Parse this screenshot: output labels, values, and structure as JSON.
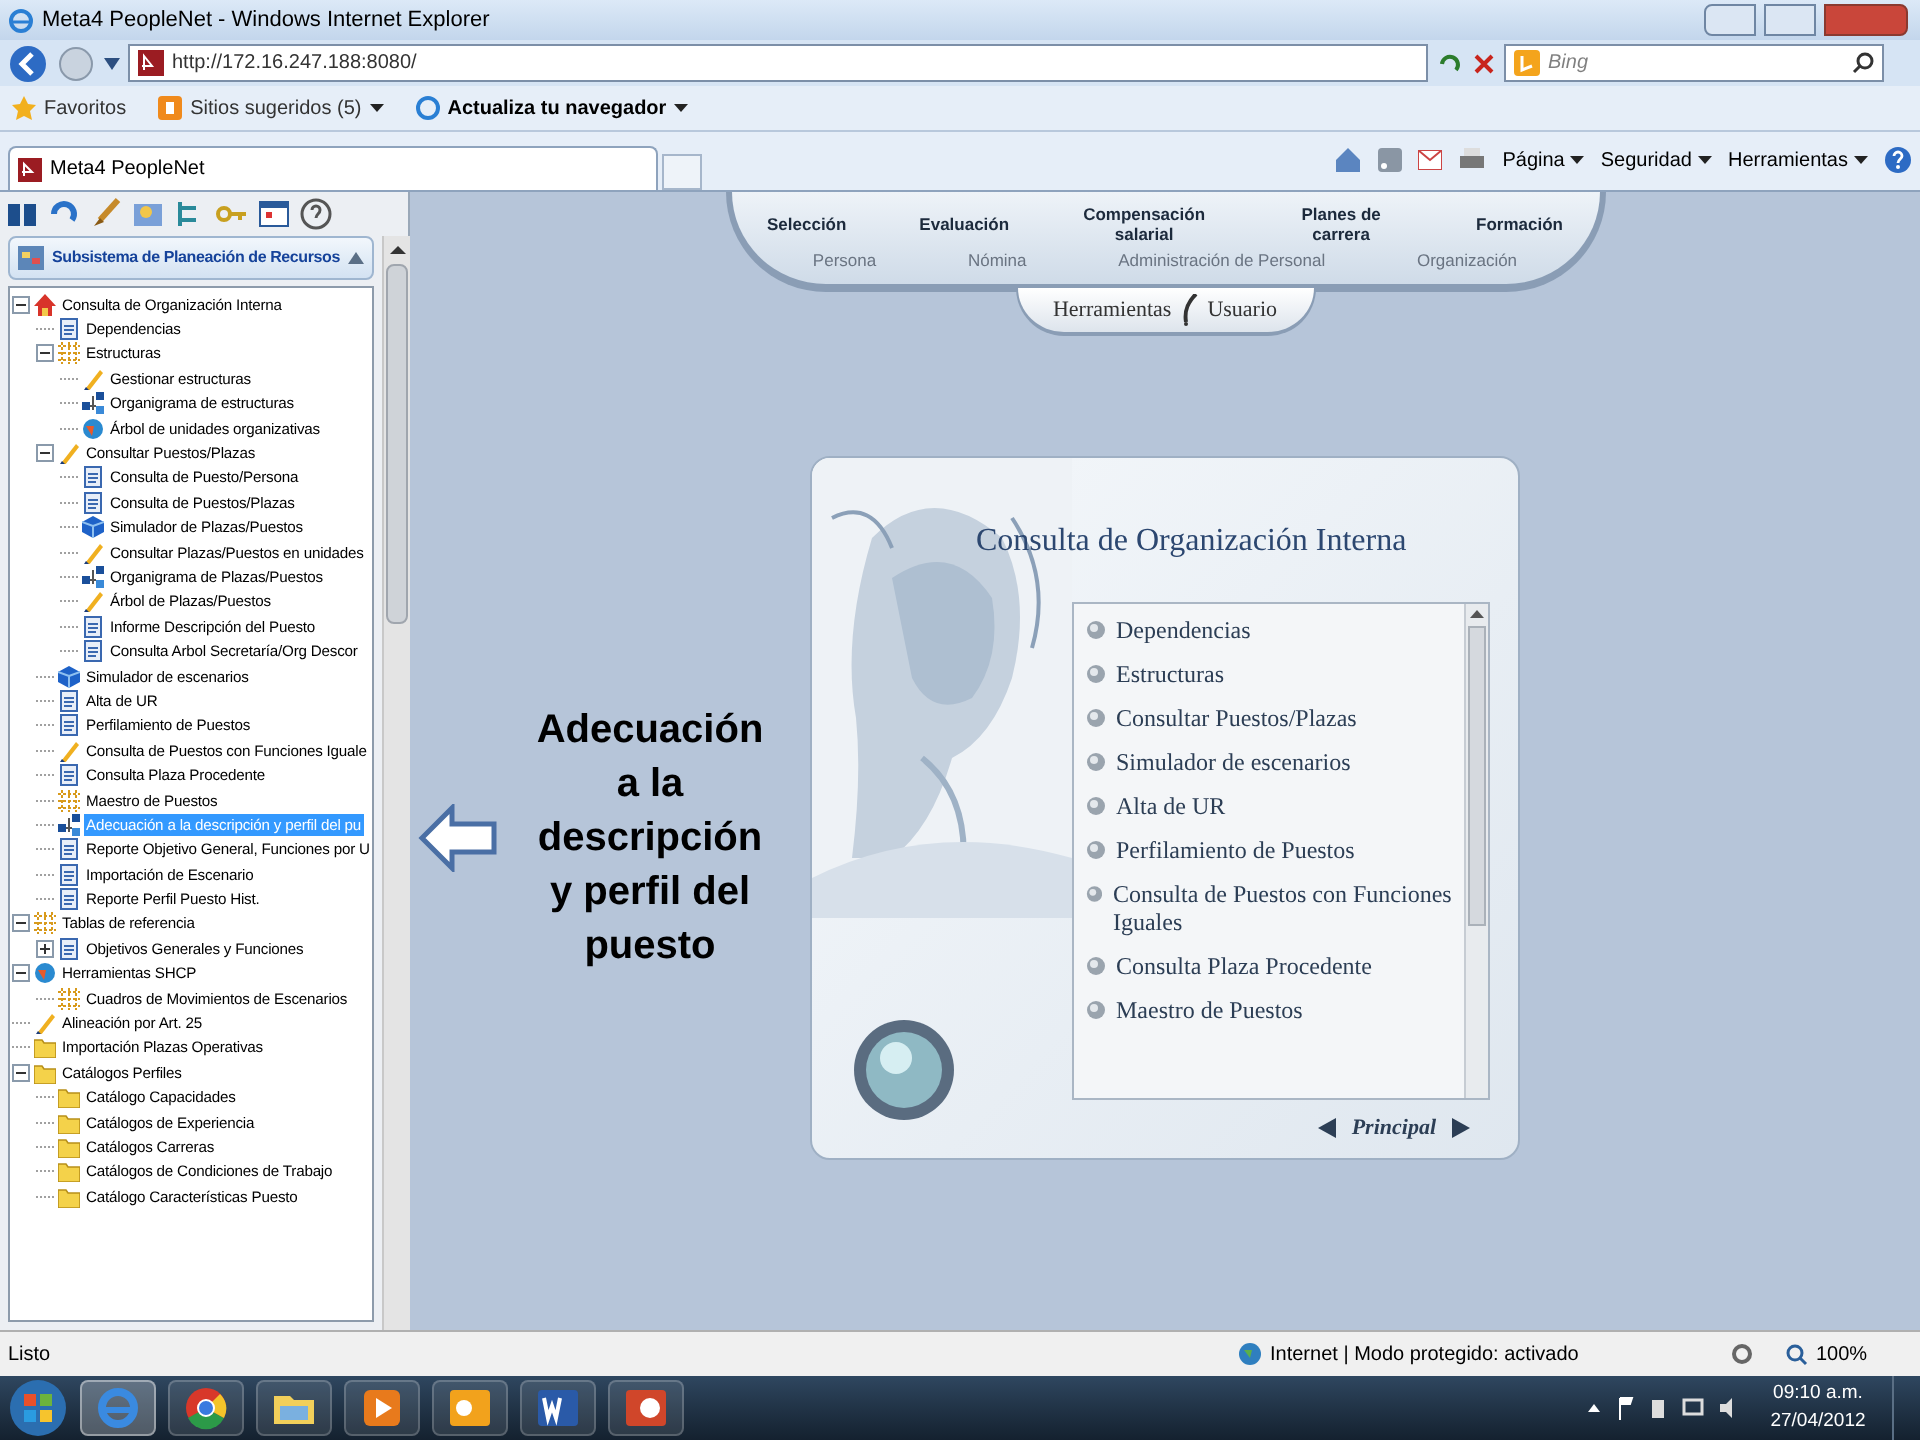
{
  "window": {
    "title": "Meta4 PeopleNet - Windows Internet Explorer"
  },
  "address_bar": {
    "url": "http://172.16.247.188:8080/",
    "search_placeholder": "Bing"
  },
  "favorites_bar": {
    "items": [
      {
        "label": "Favoritos",
        "dropdown": false
      },
      {
        "label": "Sitios sugeridos (5)",
        "dropdown": true
      },
      {
        "label": "Actualiza tu navegador",
        "dropdown": true
      }
    ]
  },
  "tabs": [
    {
      "label": "Meta4 PeopleNet",
      "selected": true
    }
  ],
  "command_bar": [
    "Página",
    "Seguridad",
    "Herramientas"
  ],
  "left_pane": {
    "header": "Subsistema de Planeación de Recursos",
    "tree": [
      {
        "label": "Consulta de Organización Interna",
        "kind": "house",
        "expanded": true,
        "selected": false,
        "children": [
          {
            "label": "Dependencias",
            "kind": "page",
            "selected": false
          },
          {
            "label": "Estructuras",
            "kind": "grid",
            "expanded": true,
            "selected": false,
            "children": [
              {
                "label": "Gestionar estructuras",
                "kind": "pen",
                "selected": false
              },
              {
                "label": "Organigrama de estructuras",
                "kind": "chart",
                "selected": false
              },
              {
                "label": "Árbol de unidades organizativas",
                "kind": "globe",
                "selected": false
              }
            ]
          },
          {
            "label": "Consultar Puestos/Plazas",
            "kind": "pen",
            "expanded": true,
            "selected": false,
            "children": [
              {
                "label": "Consulta de Puesto/Persona",
                "kind": "page",
                "selected": false
              },
              {
                "label": "Consulta de Puestos/Plazas",
                "kind": "page",
                "selected": false
              },
              {
                "label": "Simulador de Plazas/Puestos",
                "kind": "cube",
                "selected": false
              },
              {
                "label": "Consultar Plazas/Puestos en unidades",
                "kind": "pen",
                "selected": false
              },
              {
                "label": "Organigrama de Plazas/Puestos",
                "kind": "chart",
                "selected": false
              },
              {
                "label": "Árbol de Plazas/Puestos",
                "kind": "pen",
                "selected": false
              },
              {
                "label": "Informe Descripción del Puesto",
                "kind": "page",
                "selected": false
              },
              {
                "label": "Consulta Arbol  Secretaría/Org Descor",
                "kind": "page",
                "selected": false
              }
            ]
          },
          {
            "label": "Simulador de escenarios",
            "kind": "cube",
            "selected": false
          },
          {
            "label": "Alta de  UR",
            "kind": "page",
            "selected": false
          },
          {
            "label": "Perfilamiento de Puestos",
            "kind": "page",
            "selected": false
          },
          {
            "label": "Consulta de Puestos con Funciones Iguale",
            "kind": "pen",
            "selected": false
          },
          {
            "label": "Consulta Plaza Procedente",
            "kind": "page",
            "selected": false
          },
          {
            "label": "Maestro de Puestos",
            "kind": "grid",
            "selected": false
          },
          {
            "label": "Adecuación a la descripción y perfil del pu",
            "kind": "chart",
            "selected": true
          },
          {
            "label": "Reporte Objetivo General, Funciones por U",
            "kind": "page",
            "selected": false
          },
          {
            "label": "Importación de Escenario",
            "kind": "page",
            "selected": false
          },
          {
            "label": "Reporte Perfil Puesto Hist.",
            "kind": "page",
            "selected": false
          }
        ]
      },
      {
        "label": "Tablas de referencia",
        "kind": "grid",
        "expanded": true,
        "selected": false,
        "children": [
          {
            "label": "Objetivos Generales y Funciones",
            "kind": "page",
            "expanded": false,
            "selected": false
          }
        ]
      },
      {
        "label": "Herramientas SHCP",
        "kind": "globe",
        "expanded": true,
        "selected": false,
        "children": [
          {
            "label": "Cuadros de Movimientos de Escenarios",
            "kind": "grid",
            "selected": false
          }
        ]
      },
      {
        "label": "Alineación por Art. 25",
        "kind": "pen",
        "selected": false
      },
      {
        "label": "Importación Plazas Operativas",
        "kind": "folder",
        "selected": false
      },
      {
        "label": "Catálogos Perfiles",
        "kind": "folder",
        "expanded": true,
        "selected": false,
        "children": [
          {
            "label": "Catálogo Capacidades",
            "kind": "folder",
            "selected": false
          },
          {
            "label": "Catálogos de Experiencia",
            "kind": "folder",
            "selected": false
          },
          {
            "label": "Catálogos Carreras",
            "kind": "folder",
            "selected": false
          },
          {
            "label": "Catálogos de Condiciones de Trabajo",
            "kind": "folder",
            "selected": false
          },
          {
            "label": "Catálogo Características Puesto",
            "kind": "folder",
            "selected": false
          }
        ]
      }
    ]
  },
  "top_nav": {
    "primary": [
      "Selección",
      "Evaluación",
      "Compensación salarial",
      "Planes de carrera",
      "Formación"
    ],
    "secondary": [
      "Persona",
      "Nómina",
      "Administración de Personal",
      "Organización"
    ],
    "tools": [
      "Herramientas",
      "Usuario"
    ]
  },
  "panel": {
    "title": "Consulta de Organización Interna",
    "items": [
      "Dependencias",
      "Estructuras",
      "Consultar Puestos/Plazas",
      "Simulador de escenarios",
      "Alta de UR",
      "Perfilamiento de Puestos",
      "Consulta de Puestos con Funciones Iguales",
      "Consulta Plaza Procedente",
      "Maestro de Puestos"
    ],
    "footer": "Principal"
  },
  "annotation": {
    "text": "Adecuación a la descripción y perfil del puesto"
  },
  "status_bar": {
    "text": "Listo",
    "zone": "Internet | Modo protegido: activado",
    "zoom": "100%"
  },
  "taskbar": {
    "time": "09:10 a.m.",
    "date": "27/04/2012"
  }
}
